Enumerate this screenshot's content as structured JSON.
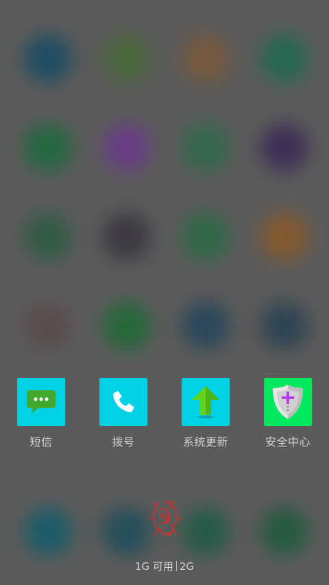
{
  "apps": [
    {
      "label": "短信",
      "icon": "message-icon",
      "bg": "#00d2e6"
    },
    {
      "label": "拨号",
      "icon": "phone-icon",
      "bg": "#00d2e6"
    },
    {
      "label": "系统更新",
      "icon": "upload-arrow-icon",
      "bg": "#00d2e6"
    },
    {
      "label": "安全中心",
      "icon": "security-shield-icon",
      "bg": "#00e85f"
    }
  ],
  "memory": {
    "free": "1G 可用",
    "total": "2G"
  },
  "colors": {
    "overlay": "#5b5b5b",
    "label": "#cfcfcf"
  }
}
